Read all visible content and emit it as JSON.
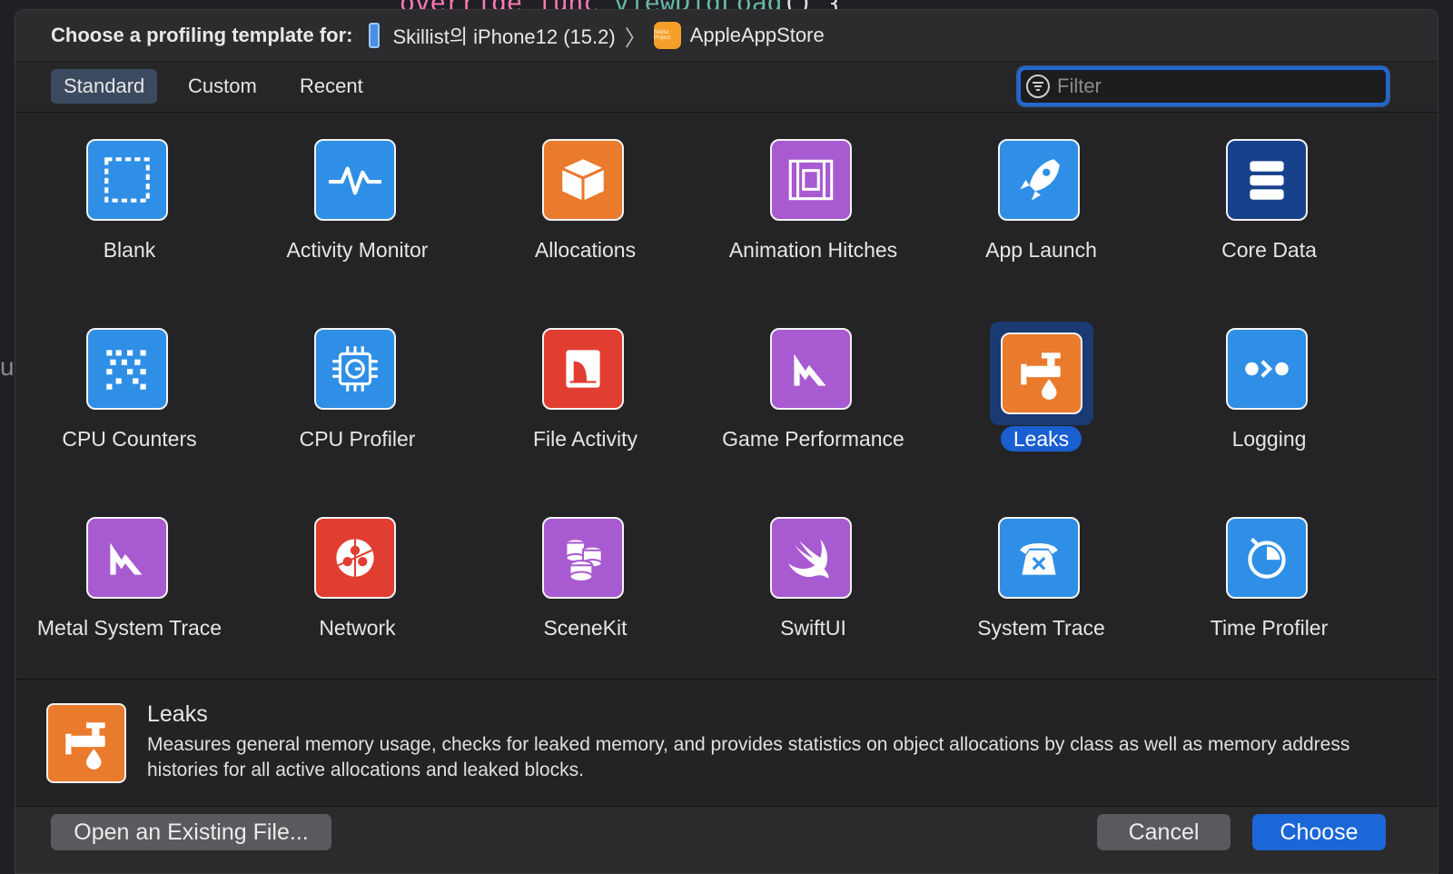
{
  "background": {
    "code_keyword": "override func",
    "code_fn": "viewDidLoad",
    "code_tail": "() {",
    "edge_glyph": "u"
  },
  "header": {
    "title": "Choose a profiling template for:",
    "device": "Skillist의 iPhone12 (15.2)",
    "separator": "〉",
    "app_icon_text": "Skillist Project",
    "app": "AppleAppStore"
  },
  "tabs": [
    {
      "label": "Standard",
      "active": true
    },
    {
      "label": "Custom",
      "active": false
    },
    {
      "label": "Recent",
      "active": false
    }
  ],
  "filter": {
    "placeholder": "Filter",
    "value": ""
  },
  "templates": [
    {
      "label": "Blank",
      "color": "#2f8fe6",
      "icon": "blank-icon"
    },
    {
      "label": "Activity Monitor",
      "color": "#2f8fe6",
      "icon": "activity-monitor-icon"
    },
    {
      "label": "Allocations",
      "color": "#ea7a2c",
      "icon": "allocations-icon"
    },
    {
      "label": "Animation Hitches",
      "color": "#a85ad1",
      "icon": "animation-hitches-icon"
    },
    {
      "label": "App Launch",
      "color": "#2f8fe6",
      "icon": "app-launch-icon"
    },
    {
      "label": "Core Data",
      "color": "#17418b",
      "icon": "core-data-icon"
    },
    {
      "label": "CPU Counters",
      "color": "#2f8fe6",
      "icon": "cpu-counters-icon"
    },
    {
      "label": "CPU Profiler",
      "color": "#2f8fe6",
      "icon": "cpu-profiler-icon"
    },
    {
      "label": "File Activity",
      "color": "#e23d31",
      "icon": "file-activity-icon"
    },
    {
      "label": "Game Performance",
      "color": "#a85ad1",
      "icon": "game-performance-icon"
    },
    {
      "label": "Leaks",
      "color": "#ea7a2c",
      "icon": "leaks-icon",
      "selected": true
    },
    {
      "label": "Logging",
      "color": "#2f8fe6",
      "icon": "logging-icon"
    },
    {
      "label": "Metal System Trace",
      "color": "#a85ad1",
      "icon": "metal-system-trace-icon"
    },
    {
      "label": "Network",
      "color": "#e23d31",
      "icon": "network-icon"
    },
    {
      "label": "SceneKit",
      "color": "#a85ad1",
      "icon": "scenekit-icon"
    },
    {
      "label": "SwiftUI",
      "color": "#a85ad1",
      "icon": "swiftui-icon"
    },
    {
      "label": "System Trace",
      "color": "#2f8fe6",
      "icon": "system-trace-icon"
    },
    {
      "label": "Time Profiler",
      "color": "#2f8fe6",
      "icon": "time-profiler-icon"
    }
  ],
  "detail": {
    "title": "Leaks",
    "description": "Measures general memory usage, checks for leaked memory, and provides statistics on object allocations by class as well as memory address histories for all active allocations and leaked blocks.",
    "icon": "leaks-icon"
  },
  "footer": {
    "open_label": "Open an Existing File...",
    "cancel_label": "Cancel",
    "choose_label": "Choose"
  }
}
